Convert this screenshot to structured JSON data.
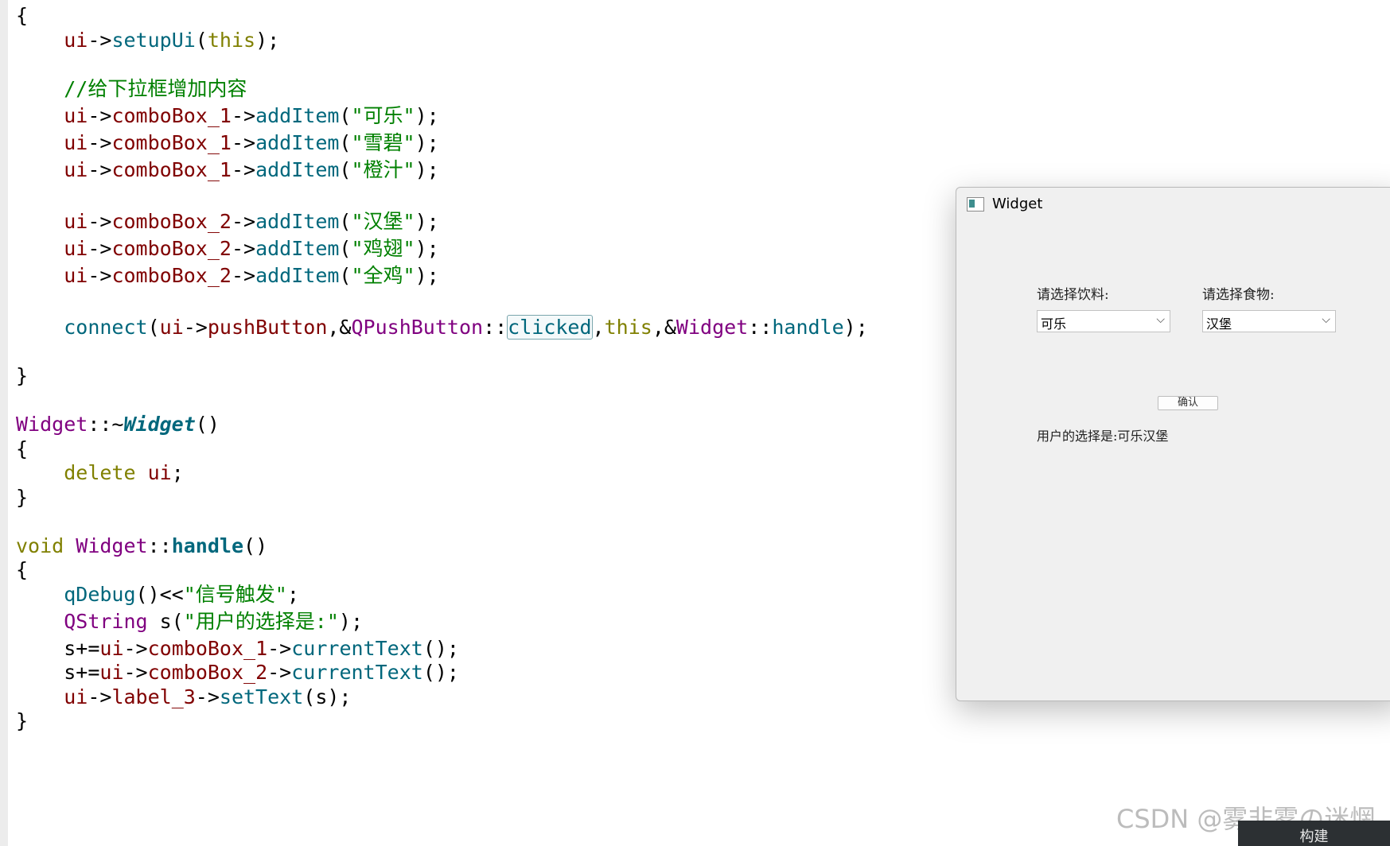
{
  "code": {
    "l01": "{",
    "l02": {
      "a": "ui",
      "b": "->",
      "c": "setupUi",
      "d": "(",
      "e": "this",
      "f": ");"
    },
    "l03": "//给下拉框增加内容",
    "l04": {
      "a": "ui",
      "b": "->",
      "c": "comboBox_1",
      "d": "->",
      "e": "addItem",
      "f": "(",
      "g": "\"可乐\"",
      "h": ");"
    },
    "l05": {
      "a": "ui",
      "b": "->",
      "c": "comboBox_1",
      "d": "->",
      "e": "addItem",
      "f": "(",
      "g": "\"雪碧\"",
      "h": ");"
    },
    "l06": {
      "a": "ui",
      "b": "->",
      "c": "comboBox_1",
      "d": "->",
      "e": "addItem",
      "f": "(",
      "g": "\"橙汁\"",
      "h": ");"
    },
    "l07": {
      "a": "ui",
      "b": "->",
      "c": "comboBox_2",
      "d": "->",
      "e": "addItem",
      "f": "(",
      "g": "\"汉堡\"",
      "h": ");"
    },
    "l08": {
      "a": "ui",
      "b": "->",
      "c": "comboBox_2",
      "d": "->",
      "e": "addItem",
      "f": "(",
      "g": "\"鸡翅\"",
      "h": ");"
    },
    "l09": {
      "a": "ui",
      "b": "->",
      "c": "comboBox_2",
      "d": "->",
      "e": "addItem",
      "f": "(",
      "g": "\"全鸡\"",
      "h": ");"
    },
    "l10": {
      "a": "connect",
      "b": "(",
      "c": "ui",
      "d": "->",
      "e": "pushButton",
      "f": ",&",
      "g": "QPushButton",
      "h": "::",
      "i": "clicked",
      "j": ",",
      "k": "this",
      "l": ",&",
      "m": "Widget",
      "n": "::",
      "o": "handle",
      "p": ");"
    },
    "l11": "}",
    "l12": {
      "a": "Widget",
      "b": "::~",
      "c": "Widget",
      "d": "()"
    },
    "l13": "{",
    "l14": {
      "a": "delete",
      "b": " ",
      "c": "ui",
      "d": ";"
    },
    "l15": "}",
    "l16": {
      "a": "void",
      "b": " ",
      "c": "Widget",
      "d": "::",
      "e": "handle",
      "f": "()"
    },
    "l17": "{",
    "l18": {
      "a": "qDebug",
      "b": "()<<",
      "c": "\"信号触发\"",
      "d": ";"
    },
    "l19": {
      "a": "QString",
      "b": " s(",
      "c": "\"用户的选择是:\"",
      "d": ");"
    },
    "l20": {
      "a": "s",
      "b": "+=",
      "c": "ui",
      "d": "->",
      "e": "comboBox_1",
      "f": "->",
      "g": "currentText",
      "h": "();"
    },
    "l21": {
      "a": "s",
      "b": "+=",
      "c": "ui",
      "d": "->",
      "e": "comboBox_2",
      "f": "->",
      "g": "currentText",
      "h": "();"
    },
    "l22": {
      "a": "ui",
      "b": "->",
      "c": "label_3",
      "d": "->",
      "e": "setText",
      "f": "(s);"
    },
    "l23": "}"
  },
  "widget": {
    "title": "Widget",
    "drink_label": "请选择饮料:",
    "food_label": "请选择食物:",
    "drink_value": "可乐",
    "food_value": "汉堡",
    "confirm_label": "确认",
    "result_text": "用户的选择是:可乐汉堡",
    "chevron": "⌵"
  },
  "watermark": "CSDN @雾非雾の迷惘",
  "build_label": "构建",
  "colors": {
    "identifier": "#800000",
    "function": "#00677c",
    "type": "#800080",
    "keyword": "#808000",
    "string": "#008000"
  }
}
